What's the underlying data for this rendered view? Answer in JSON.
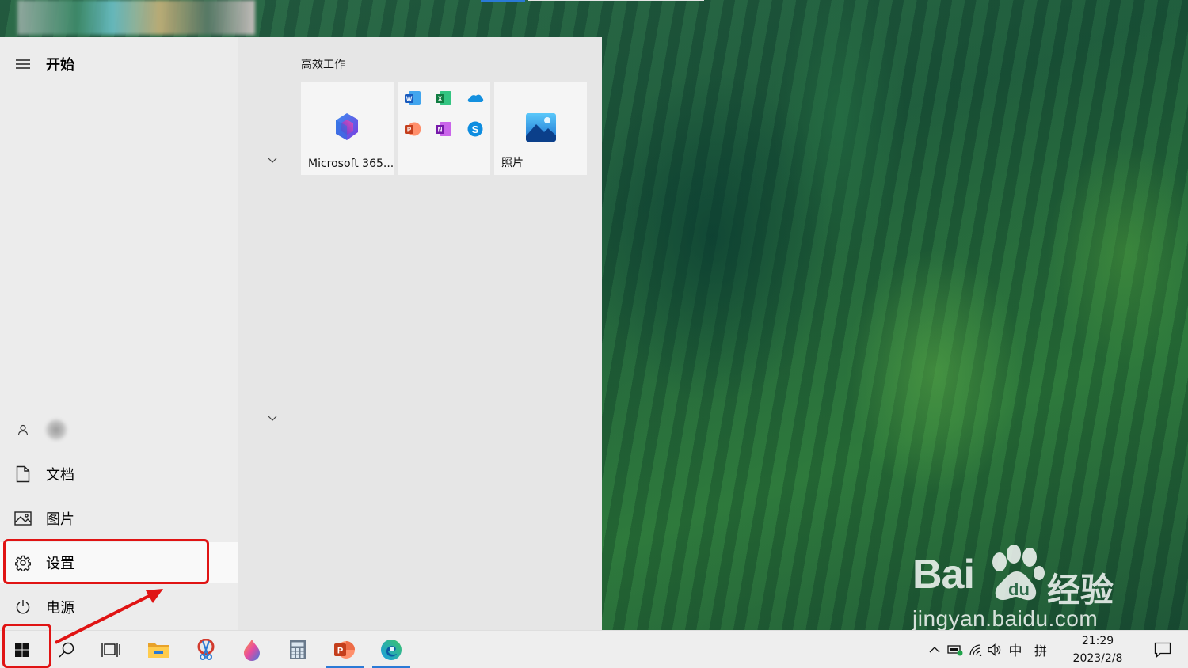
{
  "start_menu": {
    "header": "开始",
    "user_name": "",
    "left_items": [
      {
        "label": "文档",
        "icon": "document-icon"
      },
      {
        "label": "图片",
        "icon": "pictures-icon"
      },
      {
        "label": "设置",
        "icon": "gear-icon"
      },
      {
        "label": "电源",
        "icon": "power-icon"
      }
    ],
    "group_title": "高效工作",
    "tiles": [
      {
        "label": "Microsoft 365...",
        "icon": "microsoft-365-icon"
      },
      {
        "label": "",
        "icon": "office-apps-folder-icon"
      },
      {
        "label": "照片",
        "icon": "photos-icon"
      }
    ]
  },
  "taskbar": {
    "apps": [
      "start-icon",
      "search-icon",
      "task-view-icon",
      "file-explorer-icon",
      "snipping-tool-icon",
      "paint-3d-icon",
      "calculator-icon",
      "powerpoint-icon",
      "edge-icon"
    ],
    "tray": {
      "ime_lang": "中",
      "ime_mode": "拼",
      "time": "21:29",
      "date": "2023/2/8"
    }
  },
  "watermark": {
    "brand": "Bai",
    "brand_cn": "经验",
    "url": "jingyan.baidu.com"
  },
  "colors": {
    "annotation": "#e01414",
    "accent": "#2a7ad6",
    "menu_bg": "#ececec",
    "taskbar_bg": "#eeeeee"
  }
}
